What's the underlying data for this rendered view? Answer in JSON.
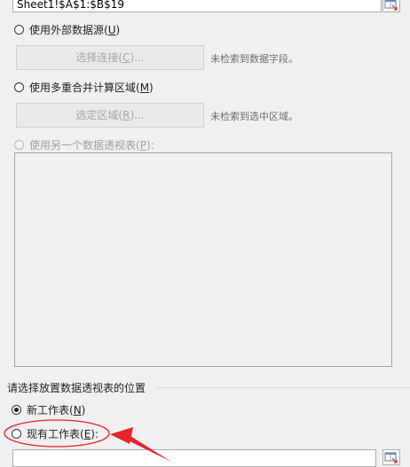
{
  "table_range": {
    "value": "Sheet1!$A$1:$B$19"
  },
  "external_source": {
    "label": "使用外部数据源(",
    "hotkey": "U",
    "label_end": ")",
    "choose_connection_label": "选择连接(",
    "choose_connection_hotkey": "C",
    "choose_connection_end": ")...",
    "hint": "未检索到数据字段。"
  },
  "multi_range": {
    "label": "使用多重合并计算区域(",
    "hotkey": "M",
    "label_end": ")",
    "select_region_label": "选定区域(",
    "select_region_hotkey": "R",
    "select_region_end": ")...",
    "hint": "未检索到选中区域。"
  },
  "another_pivot": {
    "label": "使用另一个数据透视表(",
    "hotkey": "P",
    "label_end": "):"
  },
  "placement": {
    "group_title": "请选择放置数据透视表的位置",
    "new_sheet_label": "新工作表(",
    "new_sheet_hotkey": "N",
    "new_sheet_end": ")",
    "existing_sheet_label": "现有工作表(",
    "existing_sheet_hotkey": "E",
    "existing_sheet_end": "):",
    "location_value": ""
  },
  "annotation": {
    "color": "#e8232a"
  },
  "icons": {
    "range_picker": "collapse-dialog-icon"
  }
}
